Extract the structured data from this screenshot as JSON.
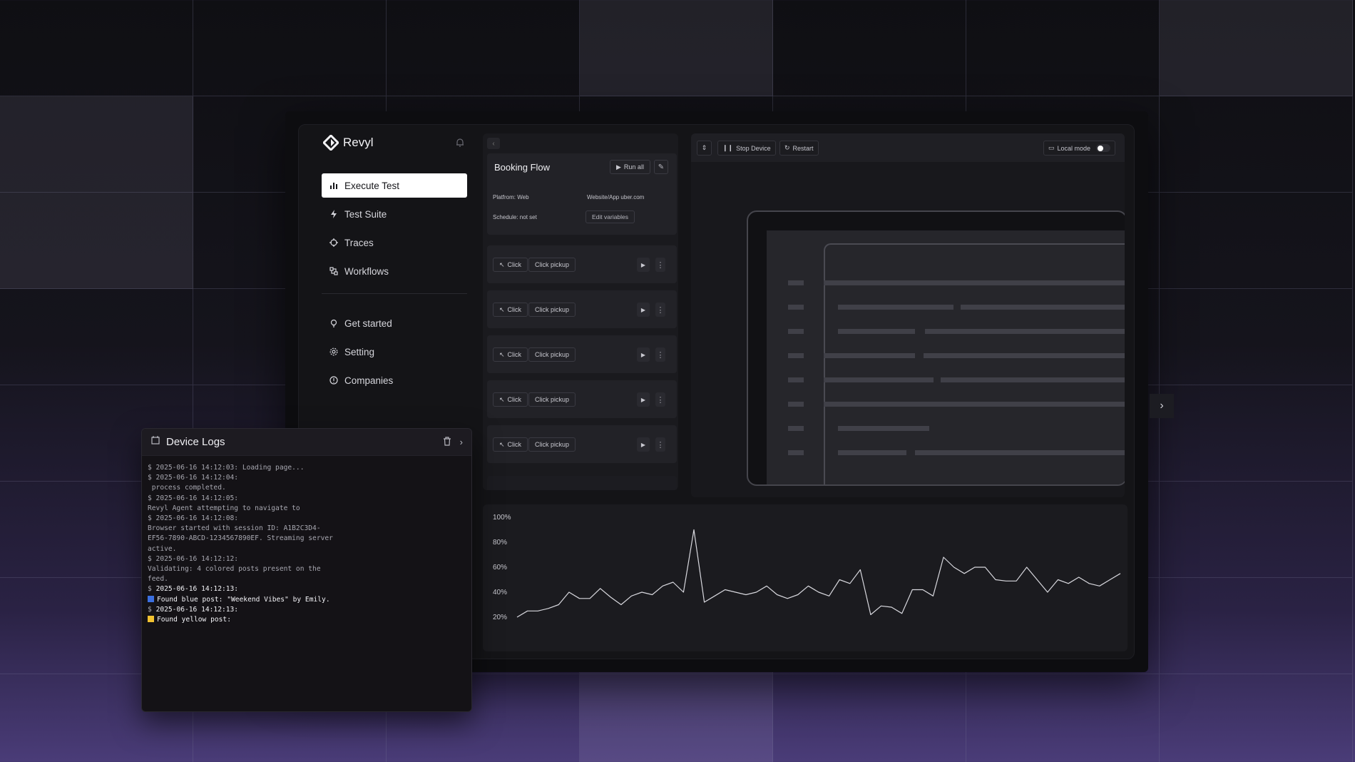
{
  "colors": {
    "accent_bg": "#ffffff",
    "blue_square": "#3b6fe0",
    "yellow_square": "#f2c230"
  },
  "app": {
    "brand": "Revyl",
    "icons": {
      "logo": "revyl-diamond-logo",
      "notification": "bell-icon"
    }
  },
  "sidebar": {
    "primary": [
      {
        "label": "Execute Test",
        "icon": "bar-chart-icon",
        "active": true
      },
      {
        "label": "Test Suite",
        "icon": "lightning-icon",
        "active": false
      },
      {
        "label": "Traces",
        "icon": "crosshair-icon",
        "active": false
      },
      {
        "label": "Workflows",
        "icon": "workflow-icon",
        "active": false
      }
    ],
    "secondary": [
      {
        "label": "Get started",
        "icon": "lightbulb-icon"
      },
      {
        "label": "Setting",
        "icon": "gear-icon"
      },
      {
        "label": "Companies",
        "icon": "info-icon"
      }
    ]
  },
  "test_panel": {
    "flow_title": "Booking Flow",
    "run_all": "Run all",
    "platform": "Platfrom: Web",
    "website": "Website/App uber.com",
    "schedule": "Schedule: not set",
    "edit_variables": "Edit variables",
    "steps": [
      {
        "action": "Click",
        "target": "Click pickup"
      },
      {
        "action": "Click",
        "target": "Click pickup"
      },
      {
        "action": "Click",
        "target": "Click pickup"
      },
      {
        "action": "Click",
        "target": "Click pickup"
      },
      {
        "action": "Click",
        "target": "Click pickup"
      }
    ]
  },
  "device_toolbar": {
    "stop_device": "Stop Device",
    "restart": "Restart",
    "local_mode": "Local mode",
    "local_mode_on": false
  },
  "chart_data": {
    "type": "line",
    "y_ticks": [
      "100%",
      "80%",
      "60%",
      "40%",
      "20%"
    ],
    "ylim": [
      20,
      100
    ],
    "values": [
      20,
      25,
      25,
      27,
      30,
      40,
      35,
      35,
      43,
      36,
      30,
      37,
      40,
      38,
      45,
      48,
      40,
      90,
      32,
      37,
      42,
      40,
      38,
      40,
      45,
      38,
      35,
      38,
      45,
      40,
      37,
      50,
      47,
      58,
      22,
      29,
      28,
      23,
      42,
      42,
      37,
      68,
      60,
      55,
      60,
      60,
      50,
      49,
      49,
      60,
      50,
      40,
      50,
      47,
      52,
      47,
      45,
      50,
      55
    ]
  },
  "logs": {
    "title": "Device Logs",
    "lines": [
      {
        "text": "$ 2025-06-16 14:12:03: Loading page...",
        "hi": false
      },
      {
        "text": "$ 2025-06-16 14:12:04:",
        "hi": false
      },
      {
        "text": " process completed.",
        "hi": false
      },
      {
        "text": "$ 2025-06-16 14:12:05:",
        "hi": false
      },
      {
        "text": "Revyl Agent attempting to navigate to",
        "hi": false
      },
      {
        "text": "$ 2025-06-16 14:12:08:",
        "hi": false
      },
      {
        "text": "Browser started with session ID: A1B2C3D4-",
        "hi": false
      },
      {
        "text": "EF56-7890-ABCD-1234567890EF. Streaming server",
        "hi": false
      },
      {
        "text": "active.",
        "hi": false
      },
      {
        "text": "$ 2025-06-16 14:12:12:",
        "hi": false
      },
      {
        "text": "Validating: 4 colored posts present on the",
        "hi": false
      },
      {
        "text": "feed.",
        "hi": false
      },
      {
        "text": "2025-06-16 14:12:13:",
        "hi": true,
        "prefix": "$ "
      },
      {
        "text": "Found blue post: \"Weekend Vibes\" by Emily.",
        "hi": true,
        "square": "blue"
      },
      {
        "text": "2025-06-16 14:12:13:",
        "hi": true,
        "prefix": "$ "
      },
      {
        "text": "Found yellow post:",
        "hi": true,
        "square": "yellow"
      }
    ]
  }
}
